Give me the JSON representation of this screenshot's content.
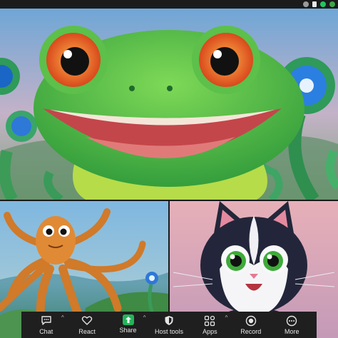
{
  "toolbar": {
    "items": [
      {
        "label": "Chat"
      },
      {
        "label": "React"
      },
      {
        "label": "Share"
      },
      {
        "label": "Host tools"
      },
      {
        "label": "Apps"
      },
      {
        "label": "Record"
      },
      {
        "label": "More"
      }
    ],
    "caret_glyph": "^"
  },
  "colors": {
    "share_accent": "#23b45a",
    "toolbar_bg": "#1f1f1f",
    "topbar_bg": "#1b1b1b"
  },
  "icons": {
    "chat": "chat-bubble-icon",
    "react": "heart-icon",
    "share": "share-arrow-icon",
    "host_tools": "shield-icon",
    "apps": "apps-grid-icon",
    "record": "record-icon",
    "more": "more-dots-icon"
  }
}
